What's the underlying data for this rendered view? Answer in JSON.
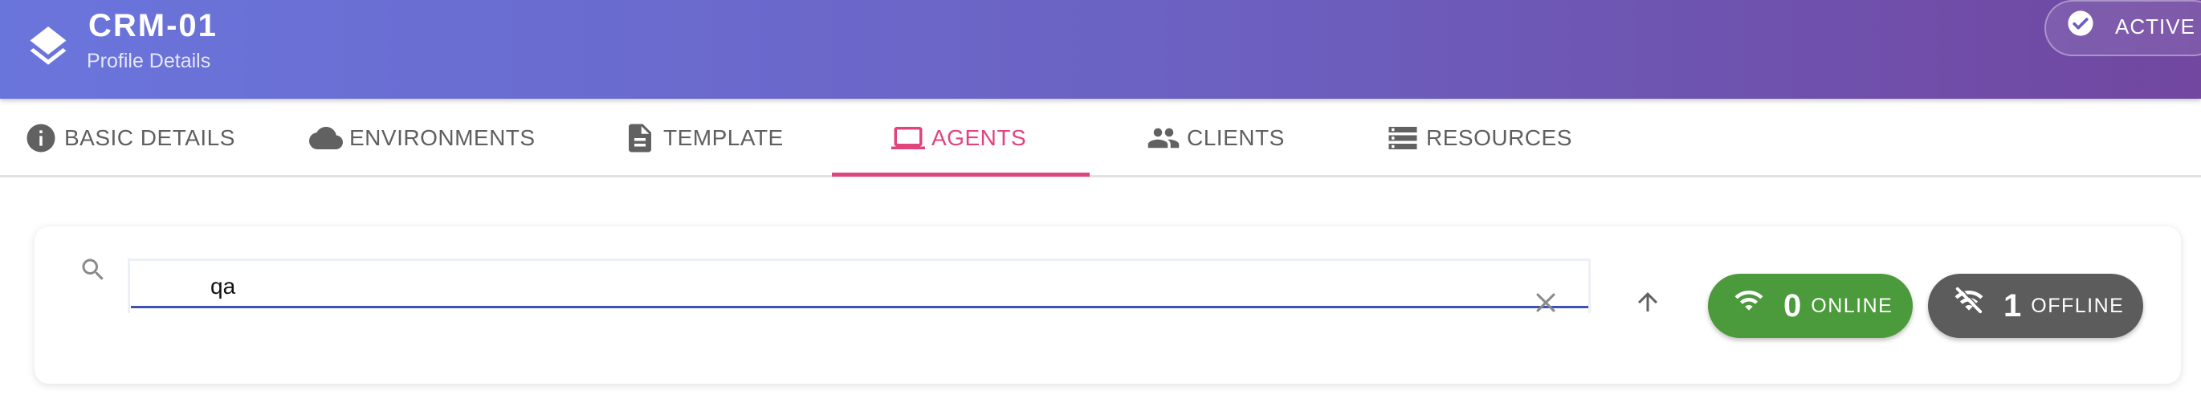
{
  "header": {
    "title": "CRM-01",
    "subtitle": "Profile Details",
    "logo_icon": "layers-icon",
    "status": {
      "label": "ACTIVE",
      "icon": "check-circle-icon"
    }
  },
  "tabs": [
    {
      "label": "BASIC DETAILS",
      "icon": "info-icon",
      "active": false
    },
    {
      "label": "ENVIRONMENTS",
      "icon": "cloud-icon",
      "active": false
    },
    {
      "label": "TEMPLATE",
      "icon": "document-icon",
      "active": false
    },
    {
      "label": "AGENTS",
      "icon": "laptop-icon",
      "active": true
    },
    {
      "label": "CLIENTS",
      "icon": "people-icon",
      "active": false
    },
    {
      "label": "RESOURCES",
      "icon": "storage-icon",
      "active": false
    }
  ],
  "search": {
    "value": "qa",
    "icon": "search-icon",
    "clear_icon": "close-icon"
  },
  "sort": {
    "icon": "arrow-up-icon"
  },
  "online": {
    "count": "0",
    "label": "ONLINE",
    "icon": "wifi-icon",
    "color": "#4b9a3b"
  },
  "offline": {
    "count": "1",
    "label": "OFFLINE",
    "icon": "wifi-off-icon",
    "color": "#5c5c5c"
  },
  "colors": {
    "accent": "#e0447d",
    "input_underline": "#3f51b5",
    "header_start": "#6a75dc",
    "header_end": "#7147a0"
  }
}
